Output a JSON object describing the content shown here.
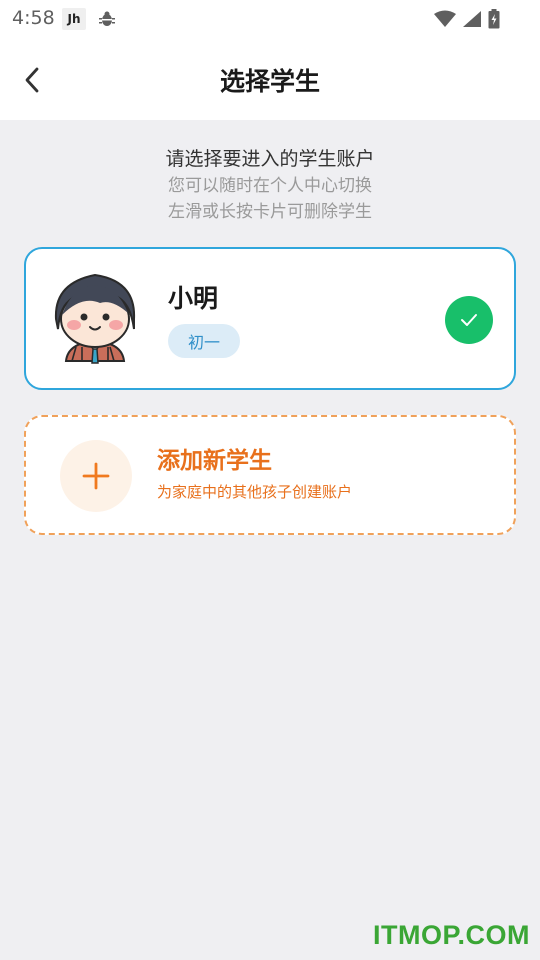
{
  "status_bar": {
    "time": "4:58",
    "app_badge": "Jh",
    "icons": [
      "wifi-icon",
      "signal-icon",
      "battery-icon"
    ]
  },
  "header": {
    "title": "选择学生",
    "back_icon": "chevron-left-icon"
  },
  "intro": {
    "line1": "请选择要进入的学生账户",
    "line2": "您可以随时在个人中心切换",
    "line3": "左滑或长按卡片可删除学生"
  },
  "students": [
    {
      "name": "小明",
      "grade": "初一",
      "selected": true
    }
  ],
  "add_student": {
    "title": "添加新学生",
    "subtitle": "为家庭中的其他孩子创建账户"
  },
  "watermark": "ITMOP.COM",
  "colors": {
    "accent_blue": "#2fa6dc",
    "check_green": "#18bf6a",
    "add_orange": "#e8701c",
    "background": "#efeff2"
  }
}
